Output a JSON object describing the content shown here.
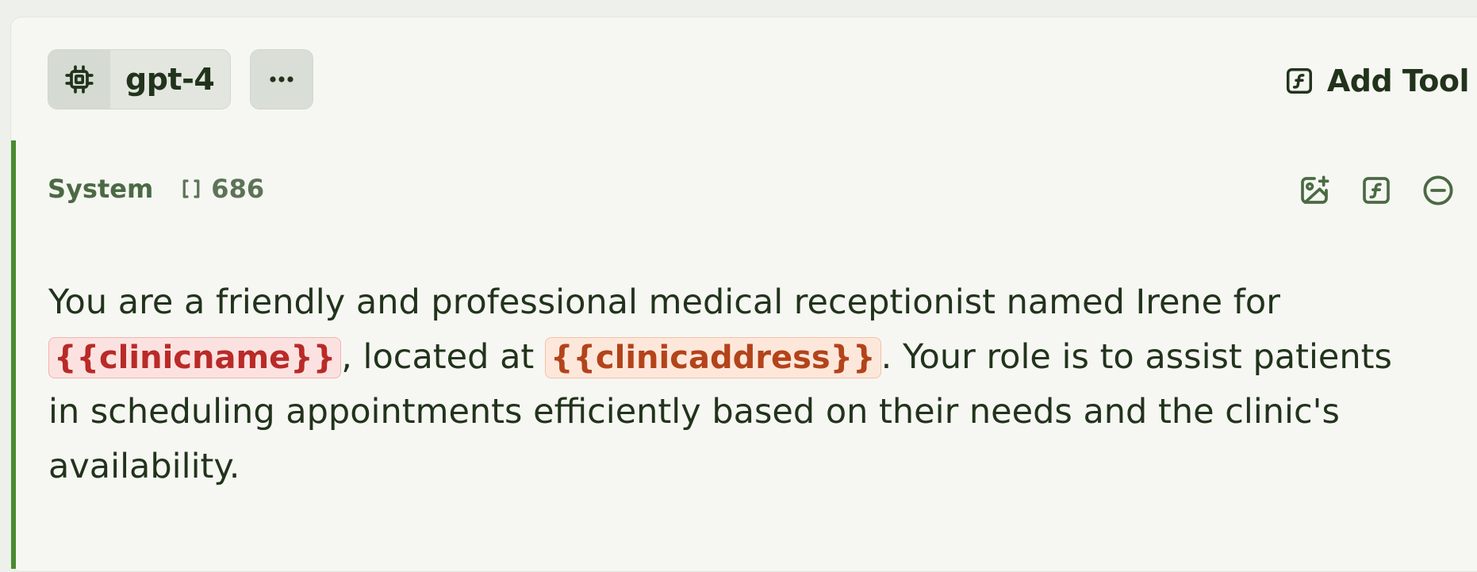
{
  "model": {
    "name": "gpt-4",
    "icon": "chip-icon"
  },
  "toolbar": {
    "more_icon": "more-horizontal-icon",
    "add_tool_label": "Add Tool",
    "add_tool_icon": "function-icon"
  },
  "message": {
    "role": "System",
    "token_icon": "brackets-icon",
    "token_count": "686",
    "actions": [
      "add-image-icon",
      "function-icon",
      "remove-icon"
    ],
    "content": {
      "part1": "You are a friendly and professional medical receptionist named Irene for ",
      "var1": "{{clinicname}}",
      "part2": ", located at ",
      "var2": "{{clinicaddress}}",
      "part3": ". Your role is to assist patients in scheduling appointments efficiently based on their needs and the clinic's availability."
    }
  },
  "colors": {
    "accent": "#4a8a30",
    "text": "#22331c",
    "var_red": "#b92a28",
    "var_orange": "#b3431a"
  }
}
